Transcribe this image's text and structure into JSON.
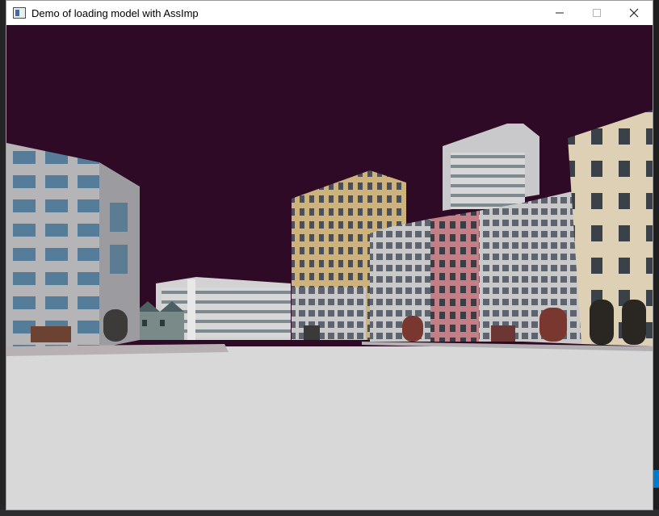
{
  "window": {
    "title": "Demo of loading model with AssImp",
    "controls": {
      "minimize": "minimize",
      "maximize": "maximize",
      "close": "close"
    }
  },
  "scene": {
    "sky_color": "#2f0a27",
    "ground_color": "#d8d8d9"
  },
  "colors": {
    "editor_bg": "#1e1e1e",
    "accent": "#007acc"
  }
}
